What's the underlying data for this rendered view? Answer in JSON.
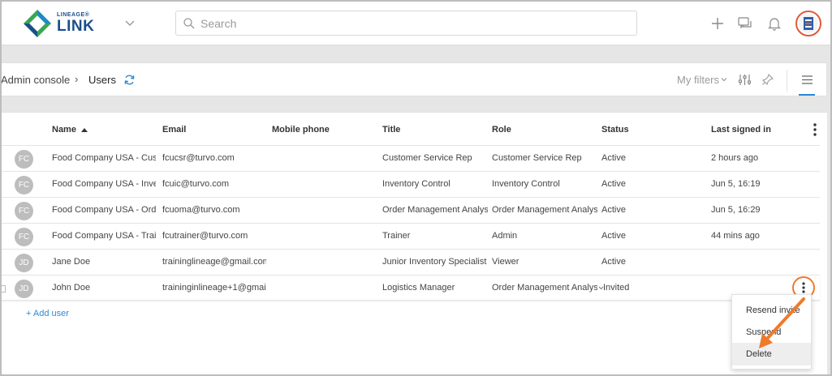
{
  "brand": {
    "small": "LINEAGE®",
    "big": "LINK"
  },
  "search": {
    "placeholder": "Search"
  },
  "breadcrumb": {
    "parent": "Admin console",
    "separator": "›",
    "current": "Users"
  },
  "toolbar": {
    "filters_label": "My filters"
  },
  "table": {
    "columns": [
      "Name",
      "Email",
      "Mobile phone",
      "Title",
      "Role",
      "Status",
      "Last signed in"
    ],
    "rows": [
      {
        "initials": "FC",
        "name": "Food Company USA - Cus...",
        "email": "fcucsr@turvo.com",
        "phone": "",
        "title": "Customer Service Rep",
        "role": "Customer Service Rep",
        "status": "Active",
        "last": "2 hours ago"
      },
      {
        "initials": "FC",
        "name": "Food Company USA - Inve...",
        "email": "fcuic@turvo.com",
        "phone": "",
        "title": "Inventory Control",
        "role": "Inventory Control",
        "status": "Active",
        "last": "Jun 5, 16:19"
      },
      {
        "initials": "FC",
        "name": "Food Company USA - Ord...",
        "email": "fcuoma@turvo.com",
        "phone": "",
        "title": "Order Management Analyst",
        "role": "Order Management Analyst",
        "status": "Active",
        "last": "Jun 5, 16:29"
      },
      {
        "initials": "FC",
        "name": "Food Company USA - Trai...",
        "email": "fcutrainer@turvo.com",
        "phone": "",
        "title": "Trainer",
        "role": "Admin",
        "status": "Active",
        "last": "44 mins ago"
      },
      {
        "initials": "JD",
        "name": "Jane Doe",
        "email": "traininglineage@gmail.com",
        "phone": "",
        "title": "Junior Inventory Specialist",
        "role": "Viewer",
        "status": "Active",
        "last": ""
      },
      {
        "initials": "JD",
        "name": "John Doe",
        "email": "traininginlineage+1@gmai...",
        "phone": "",
        "title": "Logistics Manager",
        "role": "Order Management Analyst",
        "status": "Invited",
        "last": ""
      }
    ],
    "add_user": "+ Add user"
  },
  "context_menu": {
    "items": [
      "Resend invite",
      "Suspend",
      "Delete"
    ]
  },
  "colors": {
    "accent": "#2f89d6",
    "annotation": "#ef7a2b",
    "brand_blue": "#1b4f8a",
    "brand_green": "#3aa655"
  },
  "icons": [
    "lineage-logo-icon",
    "chevron-down-icon",
    "search-icon",
    "plus-icon",
    "chat-icon",
    "bell-icon",
    "profile-avatar-icon",
    "refresh-icon",
    "tune-icon",
    "pin-icon",
    "list-view-icon",
    "sort-asc-icon",
    "kebab-icon"
  ]
}
